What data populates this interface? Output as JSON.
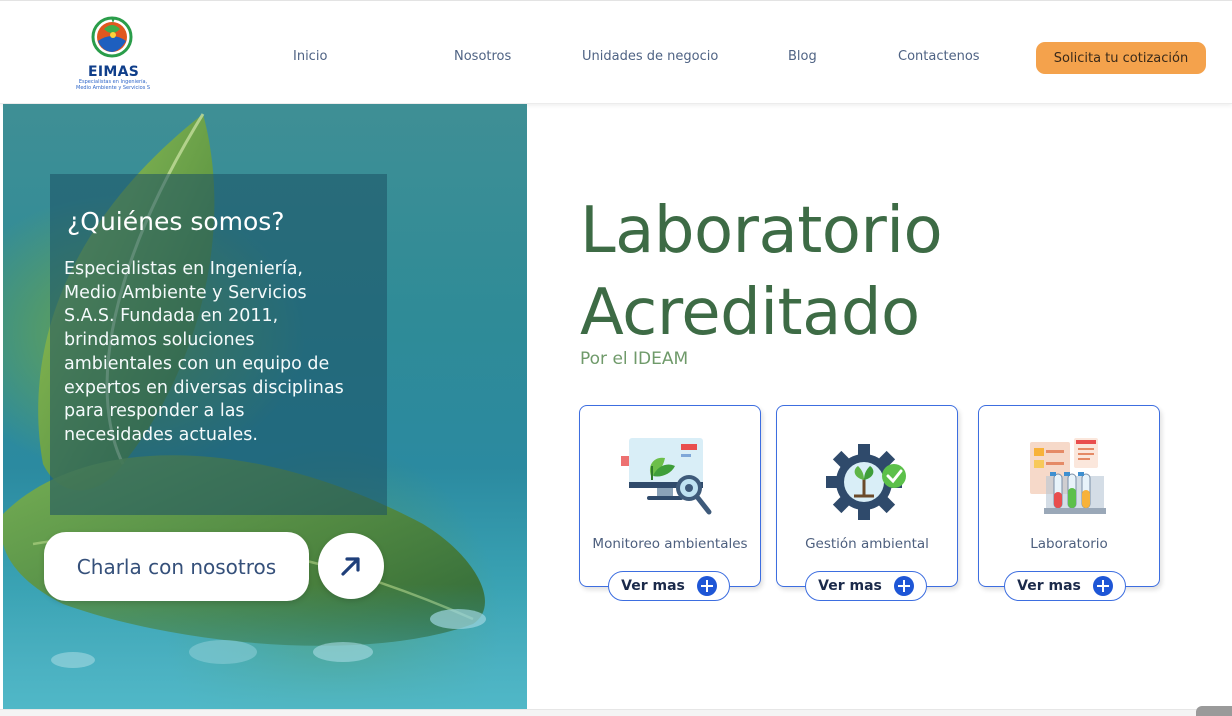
{
  "brand": {
    "name": "EIMAS",
    "tagline_1": "Especialistas en Ingeniería,",
    "tagline_2": "Medio Ambiente y Servicios S.A.S."
  },
  "nav": {
    "items": [
      "Inicio",
      "Nosotros",
      "Unidades de negocio",
      "Blog",
      "Contactenos"
    ],
    "cta_label": "Solicita tu cotización"
  },
  "about": {
    "title": "¿Quiénes somos?",
    "text": "Especialistas en Ingeniería, Medio Ambiente y Servicios S.A.S. Fundada en 2011, brindamos soluciones ambientales con un equipo de expertos en diversas disciplinas para responder a las necesidades actuales.",
    "chat_label": "Charla con nosotros",
    "arrow_icon": "arrow-up-right-icon"
  },
  "hero": {
    "line1": "Laboratorio",
    "line2": "Acreditado",
    "subtitle": "Por el IDEAM"
  },
  "services": [
    {
      "label": "Monitoreo ambientales",
      "button": "Ver mas",
      "icon": "monitoring-icon"
    },
    {
      "label": "Gestión ambiental",
      "button": "Ver mas",
      "icon": "gear-plant-icon"
    },
    {
      "label": "Laboratorio",
      "button": "Ver mas",
      "icon": "lab-tubes-icon"
    }
  ],
  "colors": {
    "accent_orange": "#f4a24c",
    "green_heading": "#3d6b45",
    "blue_border": "#3d6ee0",
    "blue_plus": "#1e56d6"
  }
}
